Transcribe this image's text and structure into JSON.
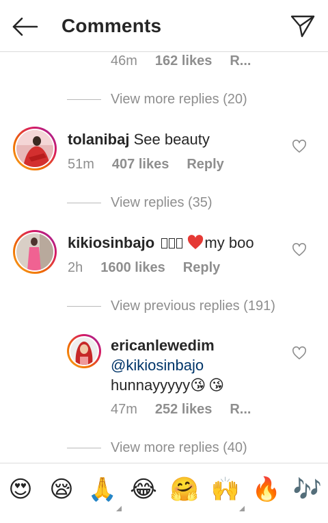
{
  "header": {
    "title": "Comments"
  },
  "top_meta": {
    "time": "46m",
    "likes": "162 likes",
    "reply": "R..."
  },
  "view_more_1": "View more replies (20)",
  "comments": [
    {
      "username": "tolanibaj",
      "text": "See beauty",
      "time": "51m",
      "likes": "407 likes",
      "reply": "Reply",
      "view_replies": "View replies (35)"
    },
    {
      "username": "kikiosinbajo",
      "text": "my boo",
      "time": "2h",
      "likes": "1600 likes",
      "reply": "Reply",
      "view_replies": "View previous replies (191)"
    }
  ],
  "reply": {
    "username": "ericanlewedim",
    "mention": "@kikiosinbajo",
    "text": "hunnayyyyy",
    "time": "47m",
    "likes": "252 likes",
    "reply": "R..."
  },
  "view_more_2": "View more replies (40)",
  "emoji_bar": [
    {
      "name": "heart-eyes",
      "char": "😍"
    },
    {
      "name": "sleepy-face",
      "char": "😪"
    },
    {
      "name": "folded-hands",
      "char": "🙏"
    },
    {
      "name": "tears-of-joy",
      "char": "😂"
    },
    {
      "name": "hugging-face",
      "char": "🤗"
    },
    {
      "name": "raising-hands",
      "char": "🙌"
    },
    {
      "name": "fire",
      "char": "🔥"
    },
    {
      "name": "musical-notes",
      "char": "🎶"
    }
  ],
  "colors": {
    "text": "#262626",
    "muted": "#8e8e8e",
    "mention": "#003569",
    "heart_red": "#e0245e",
    "divider": "#dbdbdb"
  }
}
